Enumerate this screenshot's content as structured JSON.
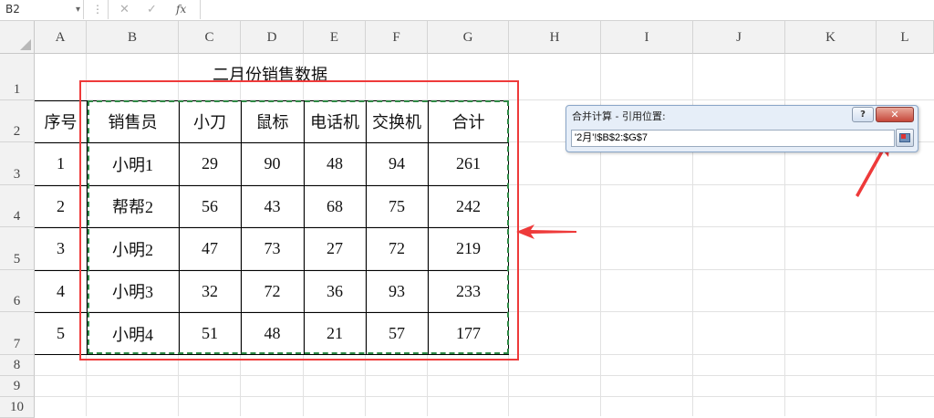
{
  "formula_bar": {
    "name_box": "B2",
    "name_box_arrow": "▾",
    "dots": "⋮",
    "cancel_glyph": "✕",
    "enter_glyph": "✓",
    "fx_glyph": "fx"
  },
  "columns": [
    "A",
    "B",
    "C",
    "D",
    "E",
    "F",
    "G",
    "H",
    "I",
    "J",
    "K",
    "L"
  ],
  "rows": [
    "1",
    "2",
    "3",
    "4",
    "5",
    "6",
    "7",
    "8",
    "9",
    "10"
  ],
  "sheet_title": "二月份销售数据",
  "table": {
    "headers": [
      "序号",
      "销售员",
      "小刀",
      "鼠标",
      "电话机",
      "交换机",
      "合计"
    ],
    "rows": [
      [
        "1",
        "小明1",
        "29",
        "90",
        "48",
        "94",
        "261"
      ],
      [
        "2",
        "帮帮2",
        "56",
        "43",
        "68",
        "75",
        "242"
      ],
      [
        "3",
        "小明2",
        "47",
        "73",
        "27",
        "72",
        "219"
      ],
      [
        "4",
        "小明3",
        "32",
        "72",
        "36",
        "93",
        "233"
      ],
      [
        "5",
        "小明4",
        "51",
        "48",
        "21",
        "57",
        "177"
      ]
    ]
  },
  "dialog": {
    "title": "合并计算 - 引用位置:",
    "help": "?",
    "close": "✕",
    "reference": "'2月'!$B$2:$G$7"
  },
  "colors": {
    "red_annotation": "#ee3a3a",
    "green_selection": "#2f8a46",
    "header_bg": "#f2f2f2"
  }
}
